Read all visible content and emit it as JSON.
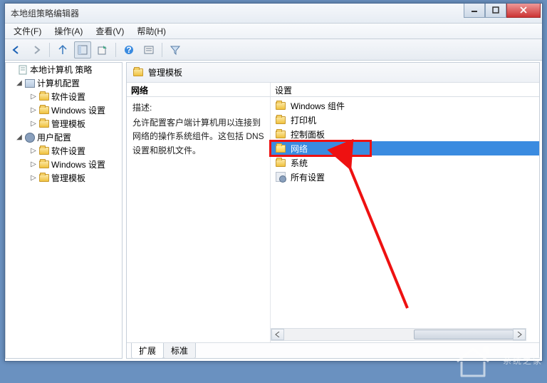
{
  "window": {
    "title": "本地组策略编辑器"
  },
  "menu": {
    "file": "文件(F)",
    "action": "操作(A)",
    "view": "查看(V)",
    "help": "帮助(H)"
  },
  "tree": {
    "root": "本地计算机 策略",
    "computer_config": "计算机配置",
    "user_config": "用户配置",
    "software_settings": "软件设置",
    "windows_settings": "Windows 设置",
    "admin_templates": "管理模板"
  },
  "right": {
    "header": "管理模板",
    "col_left": "网络",
    "col_right": "设置",
    "desc_label": "描述:",
    "desc_text": "允许配置客户端计算机用以连接到网络的操作系统组件。这包括 DNS 设置和脱机文件。",
    "items": [
      {
        "label": "Windows 组件",
        "icon": "folder"
      },
      {
        "label": "打印机",
        "icon": "folder"
      },
      {
        "label": "控制面板",
        "icon": "folder"
      },
      {
        "label": "网络",
        "icon": "folder",
        "selected": true
      },
      {
        "label": "系统",
        "icon": "folder"
      },
      {
        "label": "所有设置",
        "icon": "all"
      }
    ],
    "tabs": {
      "extended": "扩展",
      "standard": "标准"
    }
  },
  "watermark": "系统之家"
}
